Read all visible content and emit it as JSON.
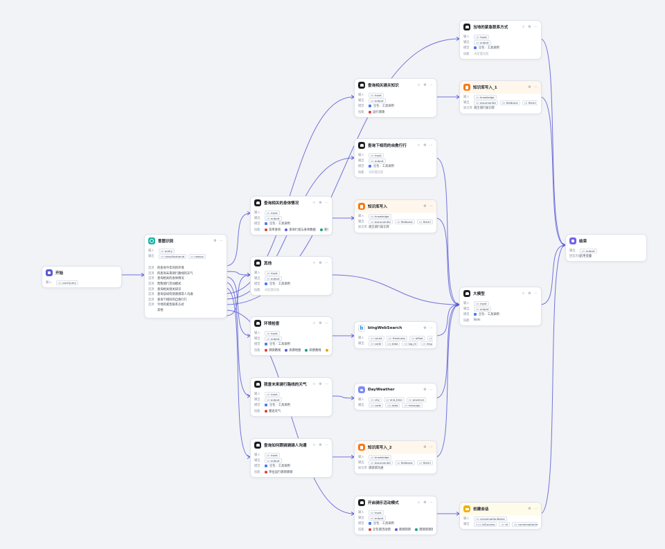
{
  "colors": {
    "edge": "#5b5bd6",
    "port": "#4f46e5",
    "canvas": "#f1f3f6"
  },
  "nodes": {
    "start": {
      "title": "开始",
      "rows": [
        {
          "label": "输入",
          "chips": [
            {
              "type": "str",
              "name": "userQuery"
            }
          ]
        }
      ]
    },
    "intent": {
      "title": "意图识别",
      "inputs": [
        {
          "label": "输入",
          "chips": [
            {
              "type": "str",
              "name": "query"
            }
          ]
        },
        {
          "label": "输出",
          "chips": [
            {
              "type": "str",
              "name": "classificationId"
            },
            {
              "type": "str",
              "name": "reason"
            }
          ]
        }
      ],
      "intents": [
        {
          "label": "选项",
          "text": "的查询今年的的环境"
        },
        {
          "label": "选项",
          "text": "的查询未来骑行路线的天气"
        },
        {
          "label": "选项",
          "text": "查询相关的身体情况"
        },
        {
          "label": "选项",
          "text": "帮我骑行活动模式"
        },
        {
          "label": "选项",
          "text": "查询相关骑关知识"
        },
        {
          "label": "选项",
          "text": "查询该如何骑骑骑哥人沟通"
        },
        {
          "label": "选项",
          "text": "查询下相同的自救行行"
        },
        {
          "label": "选项",
          "text": "今地的紧急联系方式"
        },
        {
          "label": "",
          "text": "其他"
        }
      ]
    },
    "body_status": {
      "title": "查询相关的身体情况",
      "rows": [
        {
          "label": "输入",
          "chips": [
            {
              "type": "str",
              "name": "input"
            }
          ]
        },
        {
          "label": "输出",
          "chips": [
            {
              "type": "str",
              "name": "output"
            }
          ]
        },
        {
          "label": "模型",
          "text": "豆包 · 工具调用"
        },
        {
          "label": "技能",
          "skills": [
            "其单查询",
            "查询行程与身体数据",
            "查询步步"
          ]
        }
      ]
    },
    "other": {
      "title": "其他",
      "rows": [
        {
          "label": "输入",
          "chips": [
            {
              "type": "str",
              "name": "input"
            }
          ]
        },
        {
          "label": "输出",
          "chips": [
            {
              "type": "str",
              "name": "output"
            }
          ]
        },
        {
          "label": "模型",
          "text": "豆包 · 工具调用"
        },
        {
          "label": "技能",
          "text": "未配置技能",
          "muted": true
        }
      ]
    },
    "env": {
      "title": "环境检查",
      "rows": [
        {
          "label": "输入",
          "chips": [
            {
              "type": "str",
              "name": "input"
            }
          ]
        },
        {
          "label": "输出",
          "chips": [
            {
              "type": "str",
              "name": "output"
            }
          ]
        },
        {
          "label": "模型",
          "text": "豆包 · 工具调用"
        },
        {
          "label": "技能",
          "skills": [
            "骑骑路线",
            "高德地图",
            "高德路线",
            "骑骑骑路线"
          ]
        }
      ]
    },
    "weather_q": {
      "title": "我查未来骑行路线的天气",
      "rows": [
        {
          "label": "输入",
          "chips": [
            {
              "type": "str",
              "name": "input"
            }
          ]
        },
        {
          "label": "输出",
          "chips": [
            {
              "type": "str",
              "name": "output"
            }
          ]
        },
        {
          "label": "模型",
          "text": "豆包 · 工具调用"
        },
        {
          "label": "技能",
          "skills": [
            "墨迹天气"
          ]
        }
      ]
    },
    "comm": {
      "title": "查询如何跟骑骑骑人沟通",
      "rows": [
        {
          "label": "输入",
          "chips": [
            {
              "type": "str",
              "name": "input"
            }
          ]
        },
        {
          "label": "输出",
          "chips": [
            {
              "type": "str",
              "name": "output"
            }
          ]
        },
        {
          "label": "模型",
          "text": "豆包 · 工具调用"
        },
        {
          "label": "技能",
          "skills": [
            "单位运行骑骑骑骑"
          ]
        }
      ]
    },
    "knowledge": {
      "title": "查询相关骑关知识",
      "rows": [
        {
          "label": "输入",
          "chips": [
            {
              "type": "str",
              "name": "input"
            }
          ]
        },
        {
          "label": "输出",
          "chips": [
            {
              "type": "str",
              "name": "output"
            }
          ]
        },
        {
          "label": "模型",
          "text": "豆包 · 工具调用"
        },
        {
          "label": "技能",
          "skills": [
            "运行骑骑"
          ]
        }
      ]
    },
    "rescue": {
      "title": "查询下相同的自救行行",
      "rows": [
        {
          "label": "输入",
          "chips": [
            {
              "type": "str",
              "name": "input"
            }
          ]
        },
        {
          "label": "输出",
          "chips": [
            {
              "type": "str",
              "name": "output"
            }
          ]
        },
        {
          "label": "模型",
          "text": "豆包 · 工具调用"
        },
        {
          "label": "技能",
          "text": "未配置技能",
          "muted": true
        }
      ]
    },
    "kbw_mid": {
      "title": "知识库写入",
      "rows": [
        {
          "label": "输入",
          "chips": [
            {
              "type": "str",
              "name": "knowledge"
            }
          ]
        },
        {
          "label": "输出",
          "chips": [
            {
              "type": "str",
              "name": "documentId"
            },
            {
              "type": "str",
              "name": "fileName"
            },
            {
              "type": "str",
              "name": "fileUrl"
            }
          ]
        },
        {
          "label": "知识库",
          "text": "骑全骑行知识库"
        }
      ]
    },
    "bing": {
      "title": "bingWebSearch",
      "rows": [
        {
          "label": "输入",
          "chips": [
            {
              "type": "int",
              "name": "count"
            },
            {
              "type": "str",
              "name": "freshness"
            },
            {
              "type": "int",
              "name": "offset"
            },
            {
              "type": "str",
              "name": "query"
            }
          ]
        },
        {
          "label": "输出",
          "chips": [
            {
              "type": "int",
              "name": "code"
            },
            {
              "type": "obj",
              "name": "data"
            },
            {
              "type": "str",
              "name": "log_id"
            },
            {
              "type": "str",
              "name": "msg"
            }
          ]
        }
      ]
    },
    "dayweather": {
      "title": "DayWeather",
      "rows": [
        {
          "label": "输入",
          "chips": [
            {
              "type": "str",
              "name": "city"
            },
            {
              "type": "str",
              "name": "end_time"
            },
            {
              "type": "str",
              "name": "province"
            }
          ]
        },
        {
          "label": "输出",
          "chips": [
            {
              "type": "int",
              "name": "code"
            },
            {
              "type": "obj",
              "name": "data"
            },
            {
              "type": "str",
              "name": "message"
            }
          ]
        }
      ]
    },
    "kbw_2": {
      "title": "知识库写入_2",
      "rows": [
        {
          "label": "输入",
          "chips": [
            {
              "type": "str",
              "name": "knowledge"
            }
          ]
        },
        {
          "label": "输出",
          "chips": [
            {
              "type": "str",
              "name": "documentId"
            },
            {
              "type": "str",
              "name": "fileName"
            },
            {
              "type": "str",
              "name": "fileUrl"
            }
          ]
        },
        {
          "label": "知识库",
          "text": "骑骑骑沟通"
        }
      ]
    },
    "activity": {
      "title": "开启骑乐活动模式",
      "rows": [
        {
          "label": "输入",
          "chips": [
            {
              "type": "str",
              "name": "input"
            }
          ]
        },
        {
          "label": "输出",
          "chips": [
            {
              "type": "str",
              "name": "output"
            }
          ]
        },
        {
          "label": "模型",
          "text": "豆包 · 工具调用"
        },
        {
          "label": "技能",
          "skills": [
            "豆包骑活动骑",
            "骑骑骑骑",
            "骑骑骑骑骑"
          ]
        }
      ]
    },
    "emergency": {
      "title": "当地的紧急联系方式",
      "rows": [
        {
          "label": "输入",
          "chips": [
            {
              "type": "str",
              "name": "input"
            }
          ]
        },
        {
          "label": "输出",
          "chips": [
            {
              "type": "str",
              "name": "output"
            }
          ]
        },
        {
          "label": "模型",
          "text": "豆包 · 工具调用"
        },
        {
          "label": "技能",
          "text": "未配置技能",
          "muted": true
        }
      ]
    },
    "kbw_1": {
      "title": "知识库写入_1",
      "rows": [
        {
          "label": "输入",
          "chips": [
            {
              "type": "str",
              "name": "knowledge"
            }
          ]
        },
        {
          "label": "输出",
          "chips": [
            {
              "type": "str",
              "name": "documentId"
            },
            {
              "type": "str",
              "name": "fileName"
            },
            {
              "type": "str",
              "name": "fileUrl"
            }
          ]
        },
        {
          "label": "知识库",
          "text": "骑全骑行知识库"
        }
      ]
    },
    "llm": {
      "title": "大模型",
      "rows": [
        {
          "label": "输入",
          "chips": [
            {
              "type": "str",
              "name": "input"
            }
          ]
        },
        {
          "label": "输出",
          "chips": [
            {
              "type": "str",
              "name": "output"
            }
          ]
        },
        {
          "label": "模型",
          "text": "豆包 · 工具调用"
        },
        {
          "label": "技能",
          "text": "Bots"
        }
      ]
    },
    "var": {
      "title": "创建会话",
      "rows": [
        {
          "label": "输入",
          "chips": [
            {
              "type": "str",
              "name": "conversationName"
            }
          ]
        },
        {
          "label": "输出",
          "chips": [
            {
              "type": "bool",
              "name": "isSuccess"
            },
            {
              "type": "str",
              "name": "id"
            },
            {
              "type": "str",
              "name": "conversationId"
            }
          ]
        }
      ]
    },
    "end": {
      "title": "结束",
      "rows": [
        {
          "label": "输出",
          "chips": [
            {
              "type": "str",
              "name": "output"
            }
          ]
        },
        {
          "label": "回答内容",
          "text": "启用变量"
        }
      ]
    }
  }
}
